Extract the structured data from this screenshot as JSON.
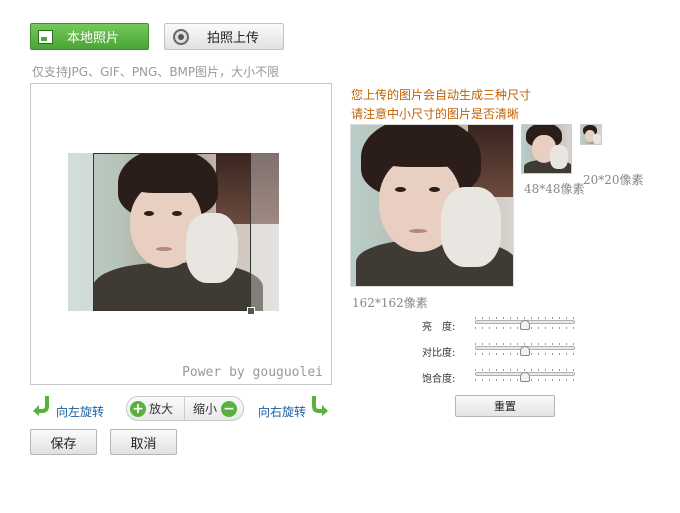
{
  "header": {
    "local_photo_label": "本地照片",
    "take_photo_label": "拍照上传"
  },
  "hint_text": "仅支持JPG、GIF、PNG、BMP图片，大小不限",
  "crop": {
    "watermark": "Power by gouguolei"
  },
  "preview": {
    "note_line1": "您上传的图片会自动生成三种尺寸",
    "note_line2": "请注意中小尺寸的图片是否清晰",
    "size_large": "162*162像素",
    "size_medium": "48*48像素",
    "size_small": "20*20像素"
  },
  "adjust": {
    "brightness_label": "亮　度:",
    "contrast_label": "对比度:",
    "saturation_label": "饱合度:",
    "brightness_value": 0.5,
    "contrast_value": 0.5,
    "saturation_value": 0.5,
    "reset_label": "重置"
  },
  "controls": {
    "rotate_left_label": "向左旋转",
    "rotate_right_label": "向右旋转",
    "zoom_in_label": "放大",
    "zoom_out_label": "缩小",
    "zoom_in_symbol": "+",
    "zoom_out_symbol": "−"
  },
  "actions": {
    "save_label": "保存",
    "cancel_label": "取消"
  },
  "colors": {
    "accent_green": "#4aa534",
    "link_blue": "#1a5fa0",
    "note_orange": "#c06000"
  }
}
